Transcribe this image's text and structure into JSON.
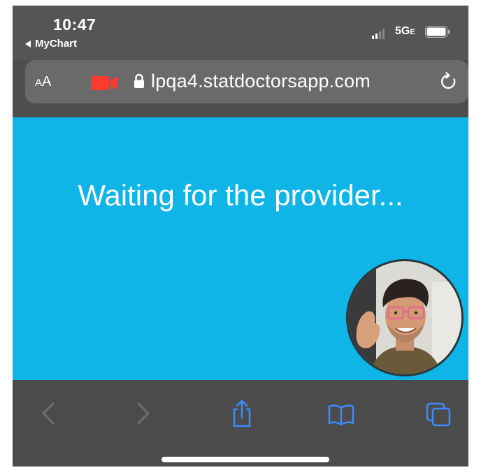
{
  "status_bar": {
    "time": "10:47",
    "back_app": "MyChart",
    "network": "5G",
    "network_suffix": "E",
    "signal_bars": 2
  },
  "address_bar": {
    "text_size_label_small": "A",
    "text_size_label_large": "A",
    "url": "lpqa4.statdoctorsapp.com",
    "camera_icon": "video-camera-icon",
    "lock_icon": "lock-icon",
    "reload_icon": "reload-icon"
  },
  "content": {
    "message": "Waiting for the provider..."
  },
  "toolbar": {
    "icons": [
      "back-icon",
      "forward-icon",
      "share-icon",
      "bookmarks-icon",
      "tabs-icon"
    ]
  },
  "colors": {
    "content_background": "#0fb5e7",
    "recording_red": "#ff3b30",
    "toolbar_icon_blue": "#3a8bff",
    "toolbar_icon_disabled": "#6f6f6f"
  }
}
